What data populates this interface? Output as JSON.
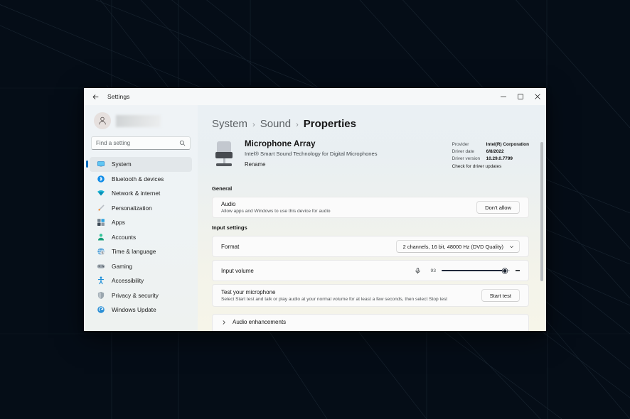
{
  "window": {
    "app_title": "Settings",
    "back_icon": "back-arrow-icon",
    "minimize_label": "−",
    "maximize_label": "☐",
    "close_label": "✕"
  },
  "sidebar": {
    "account_name_redacted": "",
    "search": {
      "placeholder": "Find a setting",
      "value": ""
    },
    "items": [
      {
        "label": "System",
        "icon": "display-monitor-icon",
        "active": true
      },
      {
        "label": "Bluetooth & devices",
        "icon": "bluetooth-icon",
        "active": false
      },
      {
        "label": "Network & internet",
        "icon": "wifi-icon",
        "active": false
      },
      {
        "label": "Personalization",
        "icon": "paintbrush-icon",
        "active": false
      },
      {
        "label": "Apps",
        "icon": "apps-grid-icon",
        "active": false
      },
      {
        "label": "Accounts",
        "icon": "person-icon",
        "active": false
      },
      {
        "label": "Time & language",
        "icon": "clock-globe-icon",
        "active": false
      },
      {
        "label": "Gaming",
        "icon": "gamepad-icon",
        "active": false
      },
      {
        "label": "Accessibility",
        "icon": "accessibility-person-icon",
        "active": false
      },
      {
        "label": "Privacy & security",
        "icon": "shield-icon",
        "active": false
      },
      {
        "label": "Windows Update",
        "icon": "update-refresh-icon",
        "active": false
      }
    ]
  },
  "main": {
    "breadcrumb": {
      "crumb1": "System",
      "sep1": "›",
      "crumb2": "Sound",
      "sep2": "›",
      "current": "Properties"
    },
    "device": {
      "icon": "desk-microphone-icon",
      "name": "Microphone Array",
      "description": "Intel® Smart Sound Technology for Digital Microphones",
      "rename_label": "Rename"
    },
    "driver_info": {
      "provider_key": "Provider",
      "provider_value": "Intel(R) Corporation",
      "date_key": "Driver date",
      "date_value": "6/8/2022",
      "version_key": "Driver version",
      "version_value": "10.29.0.7799",
      "check_updates_link": "Check for driver updates"
    },
    "general": {
      "section_label": "General",
      "audio": {
        "title": "Audio",
        "subtitle": "Allow apps and Windows to use this device for audio",
        "button_label": "Don't allow"
      }
    },
    "input_settings": {
      "section_label": "Input settings",
      "format": {
        "title": "Format",
        "selected": "2 channels, 16 bit, 48000 Hz (DVD Quality)",
        "chevron_icon": "chevron-down-icon"
      },
      "input_volume": {
        "title": "Input volume",
        "mic_icon": "microphone-icon",
        "value": "93",
        "percent": 93,
        "mute_icon": "volume-dash-icon"
      },
      "test": {
        "title": "Test your microphone",
        "subtitle": "Select Start test and talk or play audio at your normal volume for at least a few seconds, then select Stop test",
        "button_label": "Start test"
      },
      "audio_enhancements": {
        "title": "Audio enhancements",
        "chevron_icon": "chevron-right-icon"
      }
    },
    "scrollbar": {
      "name": "content-scrollbar"
    }
  },
  "colors": {
    "accent": "#0f6cbd",
    "desktop_bg": "#050d17",
    "slider_fill": "#20283a"
  }
}
